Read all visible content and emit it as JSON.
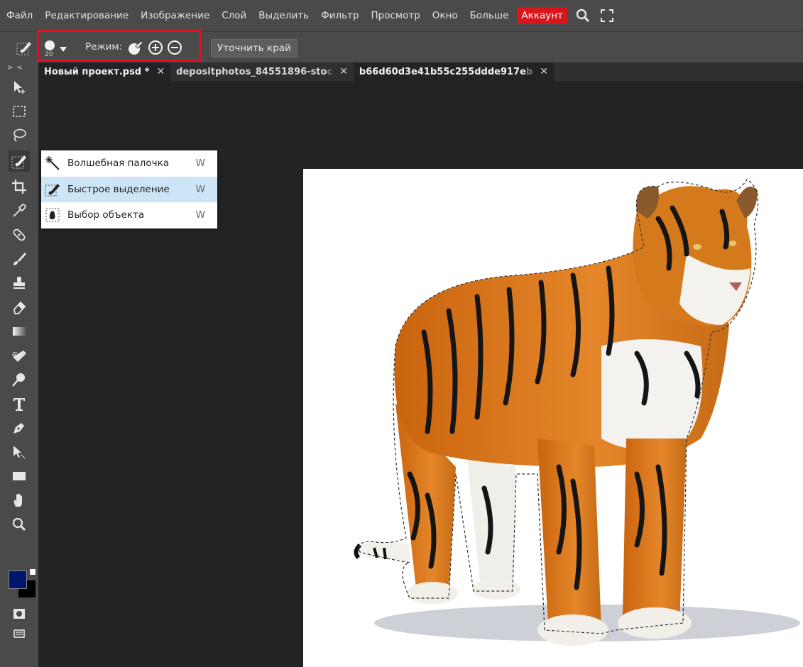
{
  "menubar": {
    "items": [
      "Файл",
      "Редактирование",
      "Изображение",
      "Слой",
      "Выделить",
      "Фильтр",
      "Просмотр",
      "Окно",
      "Больше"
    ],
    "account_label": "Аккаунт",
    "icons": [
      "search-icon",
      "fullscreen-icon"
    ]
  },
  "options": {
    "brush_size": "20",
    "mode_label": "Режим:",
    "refine_label": "Уточнить край"
  },
  "tabs": [
    {
      "label": "Новый проект.psd *",
      "fade": "",
      "active": true
    },
    {
      "label": "depositphotos_84551896-sto",
      "fade": "c",
      "active": false
    },
    {
      "label": "b66d60d3e41b55c255ddde917e",
      "fade": "b",
      "active": false
    }
  ],
  "toolbar": {
    "collapse": "> <",
    "tools": [
      "move-tool",
      "marquee-tool",
      "lasso-tool",
      "quick-selection-tool",
      "crop-tool",
      "eyedropper-tool",
      "healing-tool",
      "brush-tool",
      "stamp-tool",
      "eraser-tool",
      "gradient-tool",
      "smudge-tool",
      "dodge-tool",
      "text-tool",
      "pen-tool",
      "path-select-tool",
      "shape-tool",
      "hand-tool",
      "zoom-tool"
    ],
    "foreground_color": "#00166e",
    "background_color": "#000000"
  },
  "flyout": {
    "items": [
      {
        "label": "Волшебная палочка",
        "key": "W",
        "icon": "magic-wand-icon"
      },
      {
        "label": "Быстрое выделение",
        "key": "W",
        "icon": "quick-selection-icon"
      },
      {
        "label": "Выбор объекта",
        "key": "W",
        "icon": "object-selection-icon"
      }
    ]
  },
  "colors": {
    "accent_red": "#d9141b",
    "selected_item": "#cce6f7",
    "panel": "#4a4a4a",
    "workspace": "#222325"
  }
}
